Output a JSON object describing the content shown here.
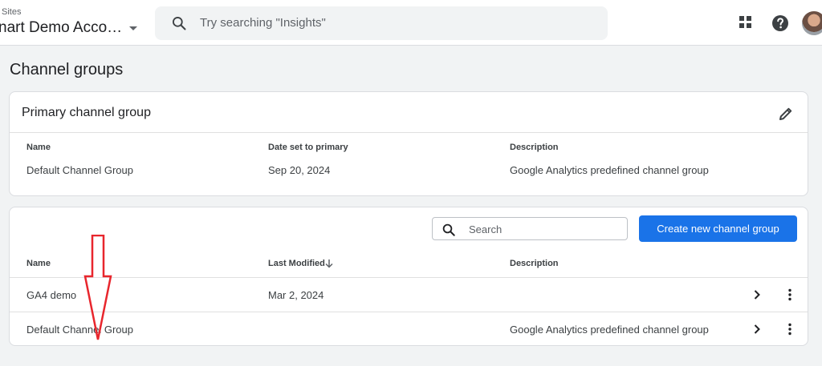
{
  "topbar": {
    "account_small": "Sites",
    "account_name": "nart Demo Acco…",
    "search_placeholder": "Try searching \"Insights\"",
    "icons": [
      "apps-grid-icon",
      "help-icon",
      "avatar"
    ]
  },
  "page": {
    "title": "Channel groups"
  },
  "primary": {
    "title": "Primary channel group",
    "columns": [
      "Name",
      "Date set to primary",
      "Description"
    ],
    "row": {
      "name": "Default Channel Group",
      "date": "Sep 20, 2024",
      "description": "Google Analytics predefined channel group"
    }
  },
  "groups": {
    "search_placeholder": "Search",
    "create_label": "Create new channel group",
    "columns": [
      "Name",
      "Last Modified",
      "Description"
    ],
    "rows": [
      {
        "name": "GA4 demo",
        "modified": "Mar 2, 2024",
        "description": ""
      },
      {
        "name": "Default Channel Group",
        "modified": "",
        "description": "Google Analytics predefined channel group"
      }
    ]
  },
  "colors": {
    "accent": "#1a73e8",
    "annotation": "#e8262d"
  }
}
